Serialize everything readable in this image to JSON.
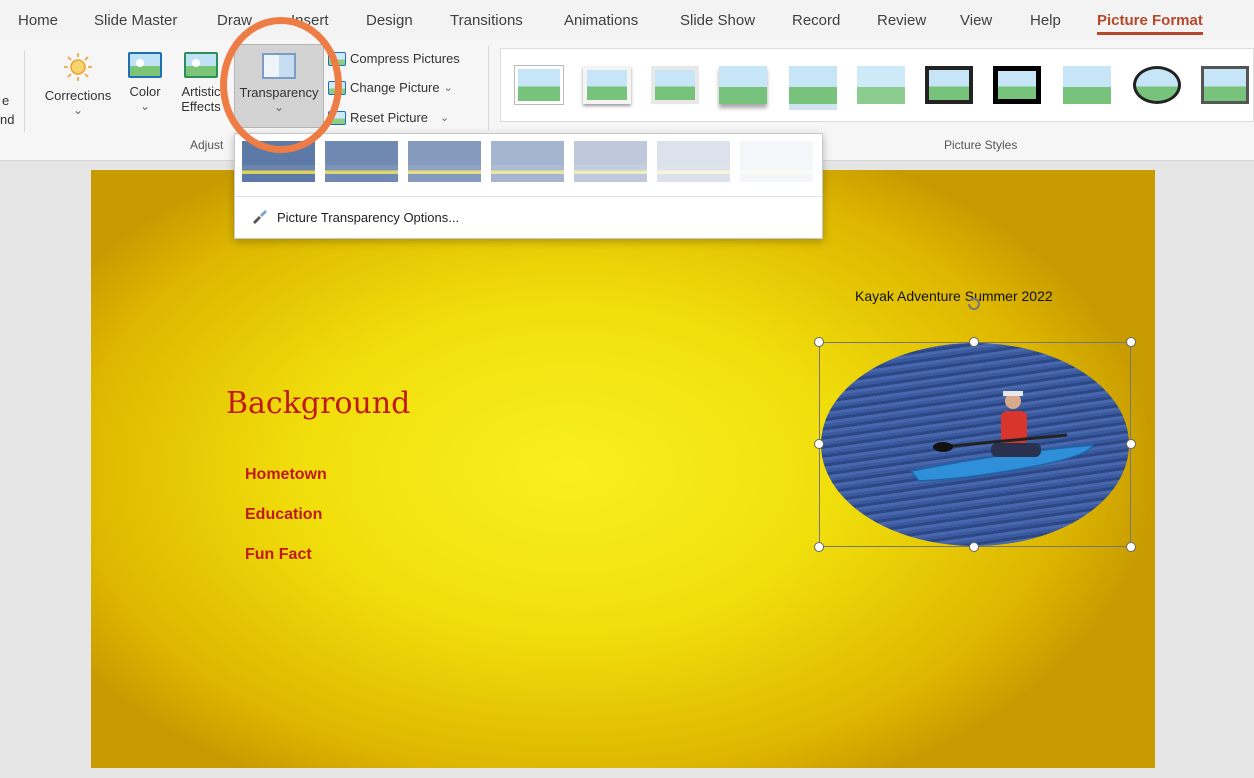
{
  "tabs": [
    "Home",
    "Slide Master",
    "Draw",
    "Insert",
    "Design",
    "Transitions",
    "Animations",
    "Slide Show",
    "Record",
    "Review",
    "View",
    "Help",
    "Picture Format"
  ],
  "active_tab": "Picture Format",
  "ribbon": {
    "left_cut": [
      "e",
      "nd"
    ],
    "corrections": "Corrections",
    "color": "Color",
    "artistic_1": "Artistic",
    "artistic_2": "Effects",
    "transparency": "Transparency",
    "compress": "Compress Pictures",
    "change": "Change Picture",
    "reset": "Reset Picture",
    "group_adjust": "Adjust",
    "group_styles": "Picture Styles",
    "dropdown_glyph": "⌄"
  },
  "transparency_menu": {
    "presets": [
      "0%",
      "15%",
      "30%",
      "50%",
      "65%",
      "80%",
      "95%"
    ],
    "options_label": "Picture Transparency Options..."
  },
  "slide": {
    "title": "Background",
    "bullets": [
      "Hometown",
      "Education",
      "Fun Fact"
    ],
    "caption": "Kayak Adventure Summer 2022"
  },
  "colors": {
    "accent": "#b7472a",
    "slide_text": "#c0191b",
    "highlight": "#ed7d45"
  },
  "icons": [
    "sun-icon",
    "color-icon",
    "artistic-effects-icon",
    "transparency-icon",
    "compress-icon",
    "change-picture-icon",
    "reset-picture-icon",
    "paintbrush-icon",
    "rotate-handle-icon"
  ]
}
